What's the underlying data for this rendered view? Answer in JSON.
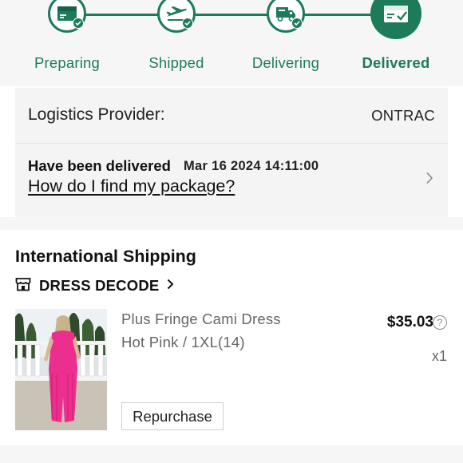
{
  "tracker": {
    "steps": [
      {
        "label": "Preparing",
        "icon": "box-icon",
        "active": false
      },
      {
        "label": "Shipped",
        "icon": "airplane-icon",
        "active": false
      },
      {
        "label": "Delivering",
        "icon": "truck-icon",
        "active": false
      },
      {
        "label": "Delivered",
        "icon": "delivered-box-icon",
        "active": true
      }
    ],
    "accent_color": "#1e7b5a"
  },
  "logistics": {
    "provider_label": "Logistics Provider:",
    "provider_value": "ONTRAC",
    "status": "Have been delivered",
    "timestamp": "Mar 16 2024 14:11:00",
    "help_link": "How do I find my package?"
  },
  "shipping": {
    "title": "International Shipping",
    "store_icon": "store-icon",
    "store_name": "DRESS DECODE"
  },
  "product": {
    "name": "Plus Fringe Cami Dress",
    "variant": "Hot Pink / 1XL(14)",
    "price": "$35.03",
    "quantity": "x1",
    "repurchase_label": "Repurchase"
  }
}
